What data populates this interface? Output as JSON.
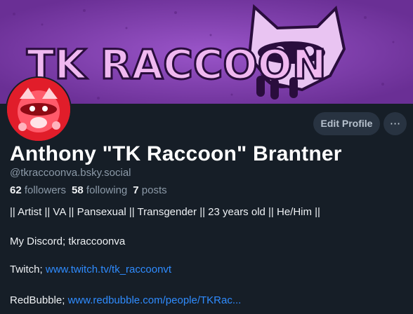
{
  "banner": {
    "text": "TK RACCOON",
    "colors": {
      "background": "#7b3fa8",
      "text": "#f0b8f0",
      "shadow": "#2a0d3d"
    }
  },
  "avatar": {
    "icon": "raccoon-avatar",
    "color": "#e11d2a"
  },
  "actions": {
    "edit_label": "Edit Profile",
    "more_label": "···"
  },
  "profile": {
    "display_name": "Anthony \"TK Raccoon\" Brantner",
    "handle": "@tkraccoonva.bsky.social",
    "followers_count": "62",
    "followers_label": "followers",
    "following_count": "58",
    "following_label": "following",
    "posts_count": "7",
    "posts_label": "posts"
  },
  "bio": {
    "line1": "|| Artist || VA || Pansexual || Transgender || 23 years old || He/Him ||",
    "discord": "My Discord; tkraccoonva",
    "twitch_label": "Twitch; ",
    "twitch_link": "www.twitch.tv/tk_raccoonvt",
    "redbubble_label": "RedBubble; ",
    "redbubble_link": "www.redbubble.com/people/TKRac..."
  },
  "colors": {
    "page_bg": "#161e27",
    "link": "#2f8cff",
    "muted": "#8c9aa8",
    "button_bg": "#283341"
  }
}
